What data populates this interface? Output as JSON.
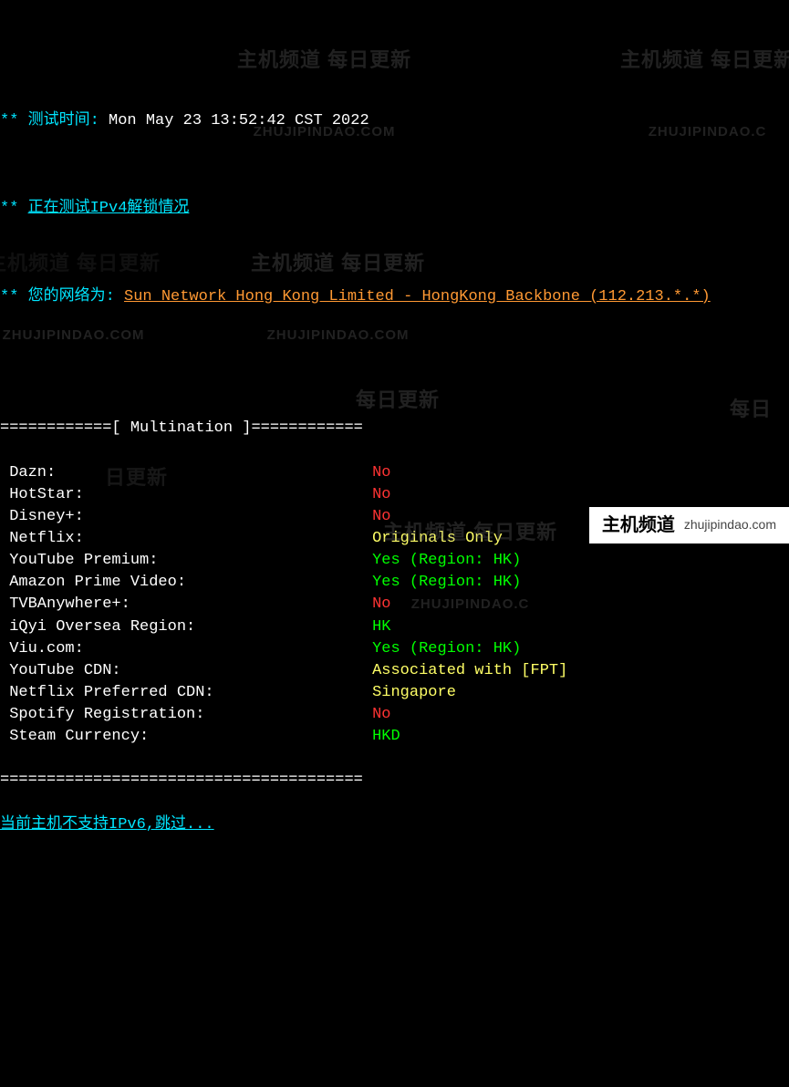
{
  "header": {
    "stars": "**",
    "test_time_label": "测试时间:",
    "test_time_value": "Mon May 23 13:52:42 CST 2022",
    "testing_label": "正在测试IPv4解锁情况",
    "network_label": "您的网络为:",
    "network_value": "Sun Network Hong Kong Limited - HongKong Backbone (112.213.*.*)"
  },
  "section": {
    "divider_left": "============[ ",
    "title": "Multination",
    "divider_right": " ]============"
  },
  "services": [
    {
      "name": "Dazn:",
      "value": "No",
      "color": "red"
    },
    {
      "name": "HotStar:",
      "value": "No",
      "color": "red"
    },
    {
      "name": "Disney+:",
      "value": "No",
      "color": "red"
    },
    {
      "name": "Netflix:",
      "value": "Originals Only",
      "color": "yellow"
    },
    {
      "name": "YouTube Premium:",
      "value": "Yes (Region: HK)",
      "color": "green"
    },
    {
      "name": "Amazon Prime Video:",
      "value": "Yes (Region: HK)",
      "color": "green"
    },
    {
      "name": "TVBAnywhere+:",
      "value": "No",
      "color": "red"
    },
    {
      "name": "iQyi Oversea Region:",
      "value": "HK",
      "color": "green"
    },
    {
      "name": "Viu.com:",
      "value": "Yes (Region: HK)",
      "color": "green"
    },
    {
      "name": "YouTube CDN:",
      "value": "Associated with [FPT]",
      "color": "yellow"
    },
    {
      "name": "Netflix Preferred CDN:",
      "value": "Singapore",
      "color": "yellow"
    },
    {
      "name": "Spotify Registration:",
      "value": "No",
      "color": "red"
    },
    {
      "name": "Steam Currency:",
      "value": "HKD",
      "color": "green"
    }
  ],
  "footer": {
    "divider": "=======================================",
    "ipv6_skip": "当前主机不支持IPv6,跳过..."
  },
  "watermark": {
    "cn": "主机频道 每日更新",
    "en": "ZHUJIPINDAO.COM",
    "en_cut": "ZHUJIPINDAO.C"
  },
  "badge": {
    "cn": "主机频道",
    "en": "zhujipindao.com"
  }
}
